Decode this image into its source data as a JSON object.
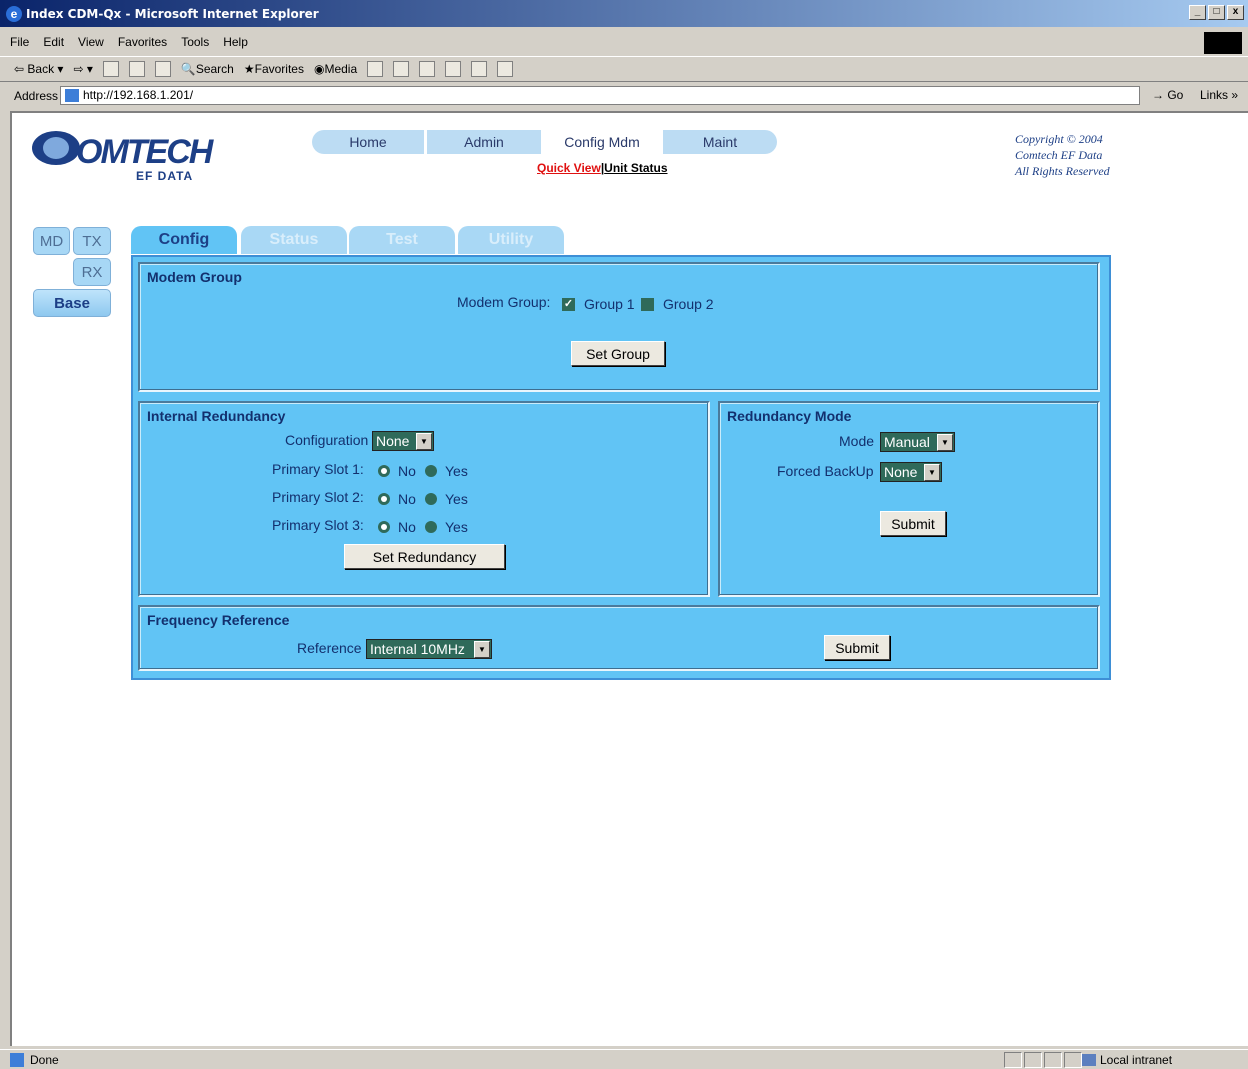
{
  "window": {
    "title": "Index CDM-Qx - Microsoft Internet Explorer",
    "controls": [
      "_",
      "□",
      "x"
    ]
  },
  "menubar": [
    "File",
    "Edit",
    "View",
    "Favorites",
    "Tools",
    "Help"
  ],
  "toolbar": {
    "back": "Back",
    "search": "Search",
    "favorites": "Favorites",
    "media": "Media"
  },
  "addressbar": {
    "label": "Address",
    "url": "http://192.168.1.201/",
    "go": "Go",
    "links": "Links"
  },
  "logo": {
    "name": "OMTECH",
    "sub": "EF DATA"
  },
  "topnav": [
    "Home",
    "Admin",
    "Config Mdm",
    "Maint"
  ],
  "quicklinks": {
    "quick_view": "Quick View",
    "separator": "|",
    "unit_status": "Unit Status"
  },
  "copyright": {
    "line1": "Copyright © 2004",
    "line2": "Comtech EF Data",
    "line3": "All Rights Reserved"
  },
  "sidenav": {
    "md": "MD",
    "tx": "TX",
    "rx": "RX",
    "base": "Base"
  },
  "tabs": [
    "Config",
    "Status",
    "Test",
    "Utility"
  ],
  "modem_group": {
    "title": "Modem Group",
    "label": "Modem Group:",
    "group1": "Group 1",
    "group2": "Group 2",
    "group1_checked": true,
    "group2_checked": false,
    "button": "Set Group"
  },
  "internal_redundancy": {
    "title": "Internal Redundancy",
    "config_label": "Configuration",
    "config_value": "None",
    "slots": [
      {
        "label": "Primary Slot 1:",
        "no": "No",
        "yes": "Yes",
        "selected": "No"
      },
      {
        "label": "Primary Slot 2:",
        "no": "No",
        "yes": "Yes",
        "selected": "No"
      },
      {
        "label": "Primary Slot 3:",
        "no": "No",
        "yes": "Yes",
        "selected": "No"
      }
    ],
    "button": "Set Redundancy"
  },
  "redundancy_mode": {
    "title": "Redundancy Mode",
    "mode_label": "Mode",
    "mode_value": "Manual",
    "backup_label": "Forced BackUp",
    "backup_value": "None",
    "button": "Submit"
  },
  "frequency_reference": {
    "title": "Frequency Reference",
    "ref_label": "Reference",
    "ref_value": "Internal 10MHz",
    "button": "Submit"
  },
  "statusbar": {
    "status": "Done",
    "zone": "Local intranet"
  }
}
